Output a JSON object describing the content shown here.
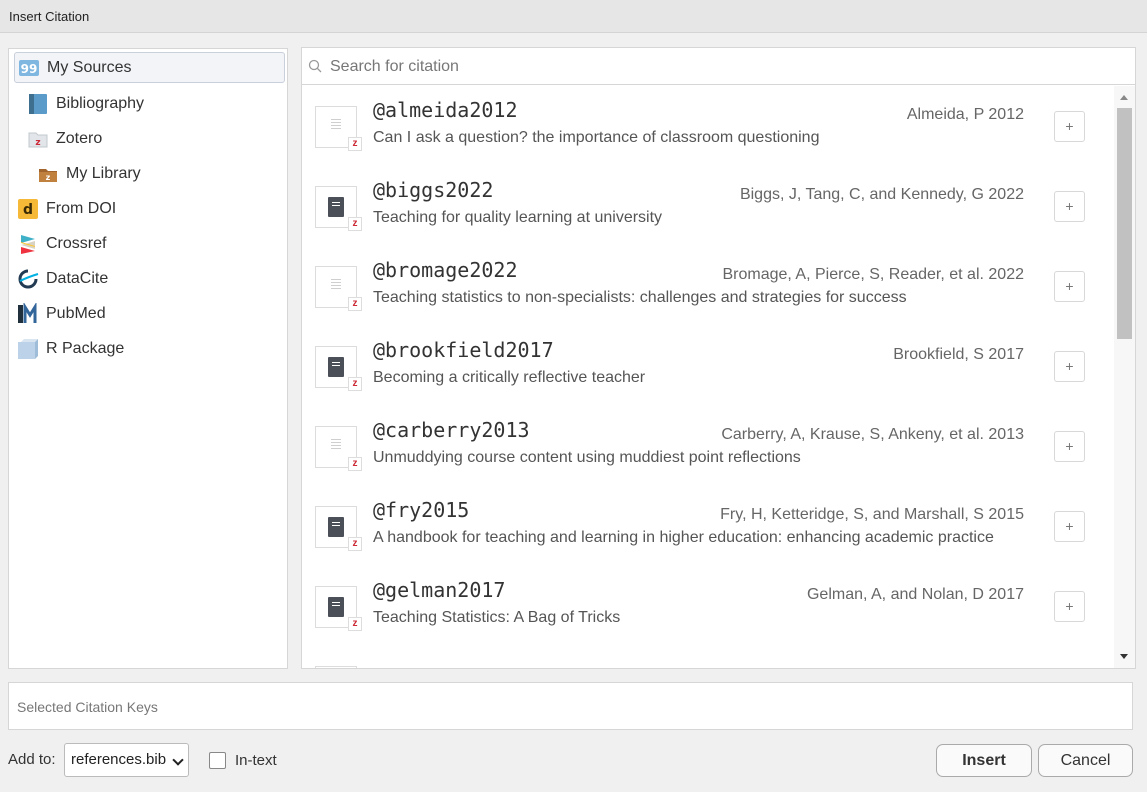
{
  "window": {
    "title": "Insert Citation"
  },
  "sources": [
    {
      "label": "My Sources",
      "icon": "quote-icon"
    },
    {
      "label": "Bibliography",
      "icon": "book-icon"
    },
    {
      "label": "Zotero",
      "icon": "zotero-folder-icon"
    },
    {
      "label": "My Library",
      "icon": "library-folder-icon"
    },
    {
      "label": "From DOI",
      "icon": "doi-icon"
    },
    {
      "label": "Crossref",
      "icon": "crossref-icon"
    },
    {
      "label": "DataCite",
      "icon": "datacite-icon"
    },
    {
      "label": "PubMed",
      "icon": "pubmed-icon"
    },
    {
      "label": "R Package",
      "icon": "package-icon"
    }
  ],
  "search": {
    "placeholder": "Search for citation"
  },
  "citations": [
    {
      "key": "@almeida2012",
      "title": "Can I ask a question? the importance of classroom questioning",
      "authors": "Almeida, P 2012",
      "icon": "document-icon",
      "add": "+"
    },
    {
      "key": "@biggs2022",
      "title": "Teaching for quality learning at university",
      "authors": "Biggs, J, Tang, C, and Kennedy, G 2022",
      "icon": "book-icon",
      "add": "+"
    },
    {
      "key": "@bromage2022",
      "title": "Teaching statistics to non-specialists: challenges and strategies for success",
      "authors": "Bromage, A, Pierce, S, Reader, et al. 2022",
      "icon": "document-icon",
      "add": "+"
    },
    {
      "key": "@brookfield2017",
      "title": "Becoming a critically reflective teacher",
      "authors": "Brookfield, S 2017",
      "icon": "book-icon",
      "add": "+"
    },
    {
      "key": "@carberry2013",
      "title": "Unmuddying course content using muddiest point reflections",
      "authors": "Carberry, A, Krause, S, Ankeny, et al. 2013",
      "icon": "document-icon",
      "add": "+"
    },
    {
      "key": "@fry2015",
      "title": "A handbook for teaching and learning in higher education: enhancing academic practice",
      "authors": "Fry, H, Ketteridge, S, and Marshall, S 2015",
      "icon": "book-icon",
      "add": "+"
    },
    {
      "key": "@gelman2017",
      "title": "Teaching Statistics: A Bag of Tricks",
      "authors": "Gelman, A, and Nolan, D 2017",
      "icon": "book-icon",
      "add": "+"
    }
  ],
  "zotero_badge": "z",
  "selected_keys": {
    "placeholder": "Selected Citation Keys"
  },
  "footer": {
    "add_to_label": "Add to:",
    "bib_file": "references.bib",
    "intext_label": "In-text",
    "insert_label": "Insert",
    "cancel_label": "Cancel"
  },
  "colors": {
    "zotero_red": "#cc2936",
    "book_dark": "#4a4f58",
    "selected_bg": "#f2f4f8"
  }
}
